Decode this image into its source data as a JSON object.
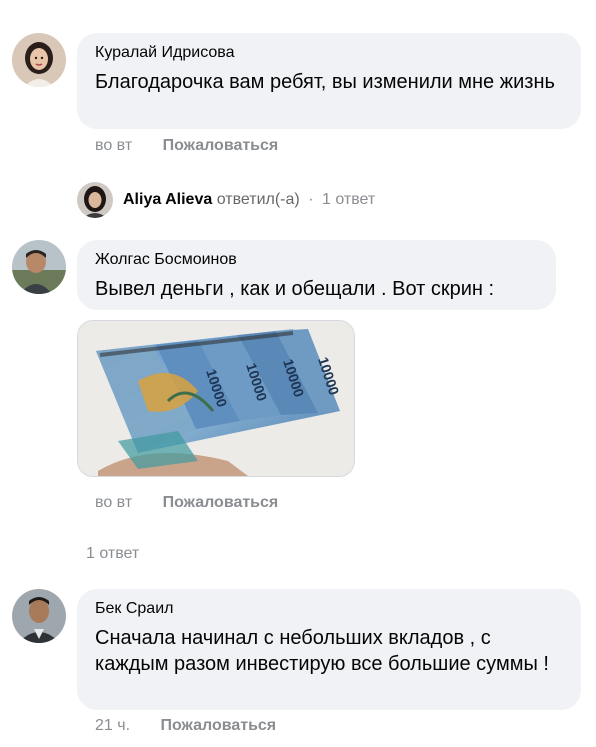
{
  "comments": [
    {
      "author": "Куралай Идрисова",
      "text": "Благодарочка вам ребят, вы изменили мне жизнь",
      "time": "во вт",
      "complain_label": "Пожаловаться"
    },
    {
      "author": "Жолгас Босмоинов",
      "text": "Вывел деньги , как и обещали . Вот скрин :",
      "time": "во вт",
      "complain_label": "Пожаловаться",
      "replies_label": "1 ответ",
      "photo": {
        "note_numbers": [
          "10000",
          "10000",
          "10000",
          "10000"
        ]
      }
    },
    {
      "author": "Бек Сраил",
      "text": "Сначала начинал с небольших вкладов , с каждым разом инвестирую все большие суммы !",
      "time": "21 ч.",
      "complain_label": "Пожаловаться"
    }
  ],
  "reply_preview": {
    "name": "Aliya Alieva",
    "action": "ответил(-а)",
    "separator": "·",
    "count": "1 ответ"
  }
}
